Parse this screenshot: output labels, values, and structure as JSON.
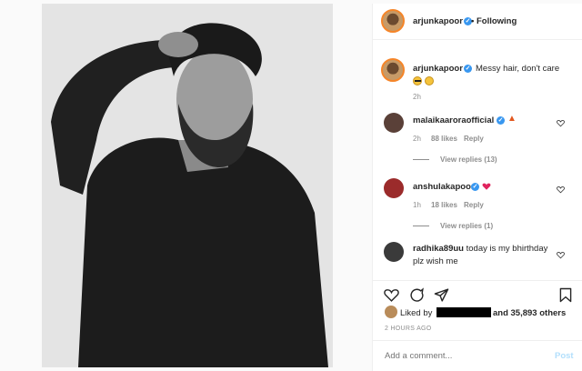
{
  "header": {
    "username": "arjunkapoor",
    "separator": "•",
    "follow_status": "Following"
  },
  "caption": {
    "username": "arjunkapoor",
    "text": "Messy hair, don't care",
    "time": "2h",
    "emojis": [
      "sunglasses-emoji",
      "grin-emoji"
    ]
  },
  "comments": [
    {
      "username": "malaikaaroraofficial",
      "text": "",
      "emoji": "fire-emoji",
      "time": "2h",
      "likes": "88 likes",
      "reply": "Reply",
      "view_replies": "View replies (13)",
      "avatar_color": "#5a4038"
    },
    {
      "username": "anshulakapoor",
      "text": "",
      "emoji": "red-heart-emoji",
      "time": "1h",
      "likes": "18 likes",
      "reply": "Reply",
      "view_replies": "View replies (1)",
      "avatar_color": "#9b2b2b"
    },
    {
      "username": "radhika89uu",
      "text": "today is my bhirthday plz wish me",
      "avatar_color": "#3a3a3a"
    }
  ],
  "likes": {
    "prefix": "Liked by",
    "suffix": "and 35,893 others"
  },
  "timestamp": "2 HOURS AGO",
  "add_comment": {
    "placeholder": "Add a comment...",
    "post_label": "Post"
  },
  "colors": {
    "accent": "#3897f0",
    "text": "#262626",
    "muted": "#8e8e8e"
  },
  "icons": [
    "heart-icon",
    "comment-icon",
    "share-icon",
    "bookmark-icon"
  ]
}
